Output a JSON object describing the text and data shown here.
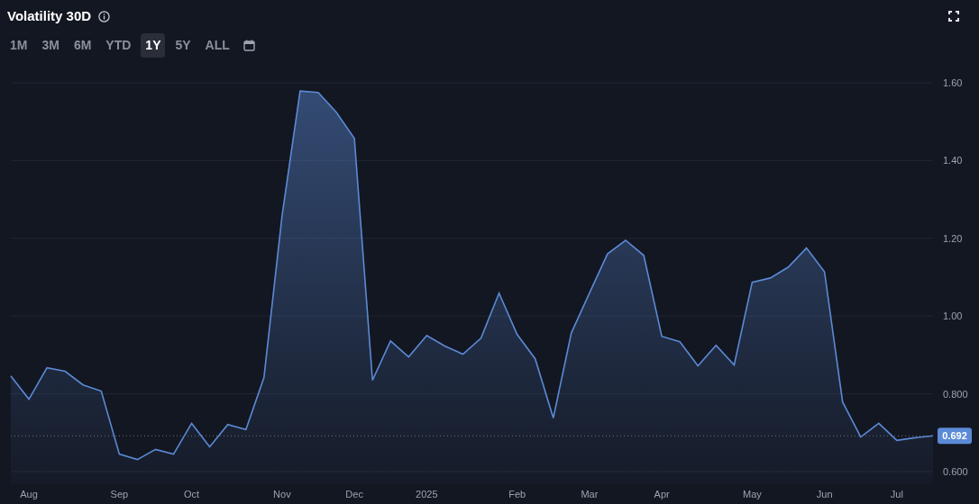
{
  "title": "Volatility 30D",
  "range_buttons": [
    {
      "label": "1M",
      "selected": false
    },
    {
      "label": "3M",
      "selected": false
    },
    {
      "label": "6M",
      "selected": false
    },
    {
      "label": "YTD",
      "selected": false
    },
    {
      "label": "1Y",
      "selected": true
    },
    {
      "label": "5Y",
      "selected": false
    },
    {
      "label": "ALL",
      "selected": false
    }
  ],
  "chart": {
    "last_value_label": "0.692",
    "chart_data": {
      "type": "area",
      "categories": [
        null,
        "Aug",
        null,
        null,
        null,
        null,
        "Sep",
        null,
        null,
        null,
        "Oct",
        null,
        null,
        null,
        null,
        "Nov",
        null,
        null,
        null,
        "Dec",
        null,
        null,
        null,
        "2025",
        null,
        null,
        null,
        null,
        "Feb",
        null,
        null,
        null,
        "Mar",
        null,
        null,
        null,
        "Apr",
        null,
        null,
        null,
        null,
        "May",
        null,
        null,
        null,
        "Jun",
        null,
        null,
        null,
        "Jul",
        null,
        null
      ],
      "series": [
        {
          "color": "#5b8ad6",
          "values": [
            0.846,
            0.786,
            0.867,
            0.858,
            0.823,
            0.807,
            0.645,
            0.631,
            0.657,
            0.645,
            0.724,
            0.664,
            0.721,
            0.708,
            0.842,
            1.258,
            1.579,
            1.575,
            1.524,
            1.457,
            0.835,
            0.936,
            0.895,
            0.95,
            0.923,
            0.902,
            0.943,
            1.059,
            0.953,
            0.89,
            0.738,
            0.957,
            1.059,
            1.16,
            1.195,
            1.156,
            0.948,
            0.934,
            0.872,
            0.925,
            0.874,
            1.087,
            1.098,
            1.126,
            1.175,
            1.114,
            0.779,
            0.689,
            0.724,
            0.68,
            0.687,
            0.692
          ]
        }
      ],
      "ylim": [
        0.6,
        1.6
      ],
      "grid": true,
      "ref_lines": [
        {
          "axis": "y",
          "value": 0.692
        }
      ],
      "yticks": [
        {
          "value": 0.6,
          "label": "0.600"
        },
        {
          "value": 0.8,
          "label": "0.800"
        },
        {
          "value": 1.0,
          "label": "1.00"
        },
        {
          "value": 1.2,
          "label": "1.20"
        },
        {
          "value": 1.4,
          "label": "1.40"
        },
        {
          "value": 1.6,
          "label": "1.60"
        }
      ]
    }
  }
}
